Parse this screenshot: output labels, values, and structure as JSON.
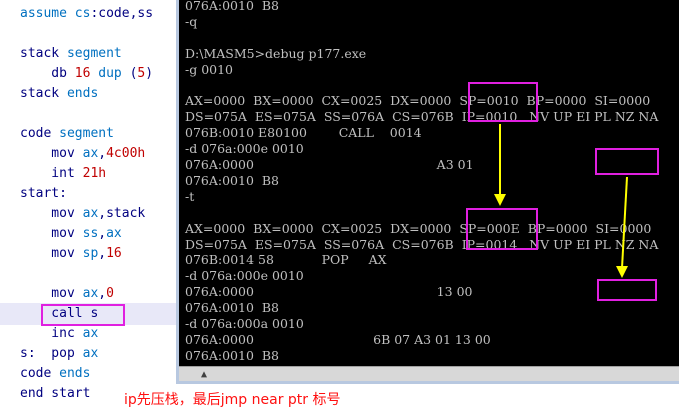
{
  "editor": {
    "lines": [
      {
        "parts": [
          [
            "assume ",
            "kw"
          ],
          [
            "cs",
            "reg"
          ],
          [
            ":code,ss",
            ""
          ]
        ]
      },
      {
        "parts": []
      },
      {
        "parts": [
          [
            "stack ",
            ""
          ],
          [
            "segment",
            "kw"
          ]
        ]
      },
      {
        "parts": [
          [
            "    db ",
            ""
          ],
          [
            "16",
            "num"
          ],
          [
            " ",
            ""
          ],
          [
            "dup",
            "kw"
          ],
          [
            " (",
            ""
          ],
          [
            "5",
            "num"
          ],
          [
            ")",
            ""
          ]
        ]
      },
      {
        "parts": [
          [
            "stack ",
            ""
          ],
          [
            "ends",
            "kw"
          ]
        ]
      },
      {
        "parts": []
      },
      {
        "parts": [
          [
            "code ",
            ""
          ],
          [
            "segment",
            "kw"
          ]
        ]
      },
      {
        "parts": [
          [
            "    mov ",
            ""
          ],
          [
            "ax",
            "reg"
          ],
          [
            ",",
            ""
          ],
          [
            "4c00h",
            "num"
          ]
        ]
      },
      {
        "parts": [
          [
            "    int ",
            ""
          ],
          [
            "21h",
            "num"
          ]
        ]
      },
      {
        "parts": [
          [
            "start:",
            ""
          ]
        ]
      },
      {
        "parts": [
          [
            "    mov ",
            ""
          ],
          [
            "ax",
            "reg"
          ],
          [
            ",stack",
            ""
          ]
        ]
      },
      {
        "parts": [
          [
            "    mov ",
            ""
          ],
          [
            "ss",
            "reg"
          ],
          [
            ",",
            ""
          ],
          [
            "ax",
            "reg"
          ]
        ]
      },
      {
        "parts": [
          [
            "    mov ",
            ""
          ],
          [
            "sp",
            "reg"
          ],
          [
            ",",
            ""
          ],
          [
            "16",
            "num"
          ]
        ]
      },
      {
        "parts": []
      },
      {
        "parts": [
          [
            "    mov ",
            ""
          ],
          [
            "ax",
            "reg"
          ],
          [
            ",",
            ""
          ],
          [
            "0",
            "num"
          ]
        ]
      },
      {
        "parts": [
          [
            "    call s",
            ""
          ]
        ]
      },
      {
        "parts": [
          [
            "    inc ",
            ""
          ],
          [
            "ax",
            "reg"
          ]
        ]
      },
      {
        "parts": [
          [
            "s:  pop ",
            ""
          ],
          [
            "ax",
            "reg"
          ]
        ]
      },
      {
        "parts": [
          [
            "code ",
            ""
          ],
          [
            "ends",
            "kw"
          ]
        ]
      },
      {
        "parts": [
          [
            "end start",
            ""
          ]
        ]
      }
    ]
  },
  "console": {
    "lines": [
      "076A:0010  B8",
      "-q",
      "",
      "D:\\MASM5>debug p177.exe",
      "-g 0010",
      "",
      "AX=0000  BX=0000  CX=0025  DX=0000  SP=0010  BP=0000  SI=0000",
      "DS=075A  ES=075A  SS=076A  CS=076B  IP=0010   NV UP EI PL NZ NA",
      "076B:0010 E80100        CALL    0014",
      "-d 076a:000e 0010",
      "076A:0000                                              A3 01",
      "076A:0010  B8",
      "-t",
      "",
      "AX=0000  BX=0000  CX=0025  DX=0000  SP=000E  BP=0000  SI=0000",
      "DS=075A  ES=075A  SS=076A  CS=076B  IP=0014   NV UP EI PL NZ NA",
      "076B:0014 58            POP     AX",
      "-d 076a:000e 0010",
      "076A:0000                                              13 00",
      "076A:0010  B8",
      "-d 076a:000a 0010",
      "076A:0000                              6B 07 A3 01 13 00",
      "076A:0010  B8",
      "-_"
    ]
  },
  "caption": "ip先压栈，最后jmp near ptr 标号",
  "colors": {
    "highlight_box": "#e020e0",
    "arrow": "#ffff00",
    "caption": "#ff1010"
  }
}
